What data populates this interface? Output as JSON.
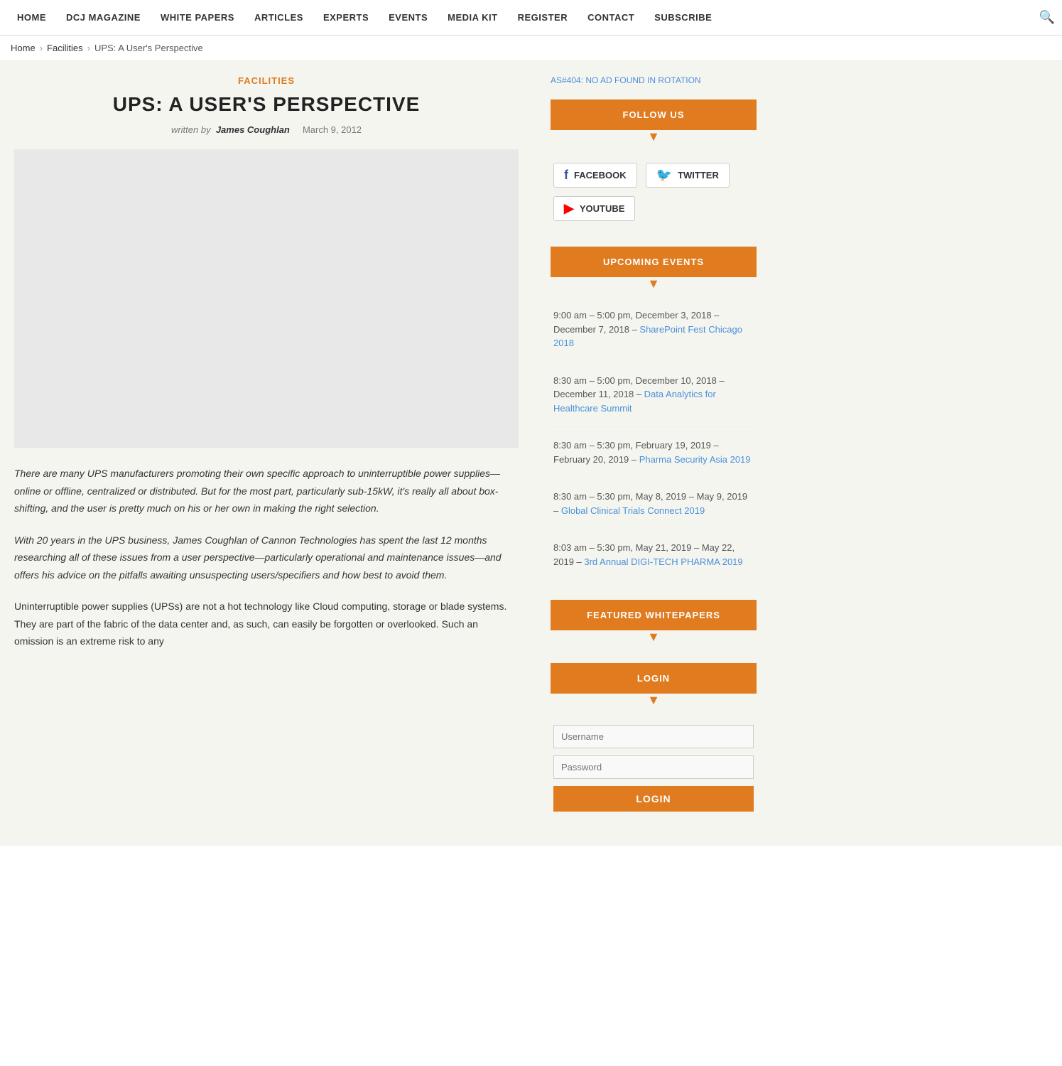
{
  "nav": {
    "items": [
      {
        "label": "HOME",
        "href": "#"
      },
      {
        "label": "DCJ MAGAZINE",
        "href": "#"
      },
      {
        "label": "WHITE PAPERS",
        "href": "#"
      },
      {
        "label": "ARTICLES",
        "href": "#"
      },
      {
        "label": "EXPERTS",
        "href": "#"
      },
      {
        "label": "EVENTS",
        "href": "#"
      },
      {
        "label": "MEDIA KIT",
        "href": "#"
      },
      {
        "label": "REGISTER",
        "href": "#"
      },
      {
        "label": "CONTACT",
        "href": "#"
      },
      {
        "label": "SUBSCRIBE",
        "href": "#"
      }
    ]
  },
  "breadcrumb": {
    "home": "Home",
    "facilities": "Facilities",
    "current": "UPS: A User's Perspective"
  },
  "article": {
    "category": "FACILITIES",
    "title": "UPS: A USER'S PERSPECTIVE",
    "written_by": "written by",
    "author": "James Coughlan",
    "date": "March 9, 2012",
    "body": [
      "There are many UPS manufacturers promoting their own specific approach to uninterruptible power supplies—online or offline, centralized or distributed. But for the most part, particularly sub-15kW, it's really all about box-shifting, and the user is pretty much on his or her own in making the right selection.",
      "With 20 years in the UPS business, James Coughlan of Cannon Technologies has spent the last 12 months researching all of these issues from a user perspective—particularly operational and maintenance issues—and offers his advice on the pitfalls awaiting unsuspecting users/specifiers and how best to avoid them.",
      "Uninterruptible power supplies (UPSs) are not a hot technology like Cloud computing, storage or blade systems. They are part of the fabric of the data center and, as such, can easily be forgotten or overlooked. Such an omission is an extreme risk to any"
    ]
  },
  "sidebar": {
    "ad_text": "AS#404: NO AD FOUND IN ROTATION",
    "follow_us": {
      "header": "FOLLOW US",
      "facebook_label": "FACEBOOK",
      "twitter_label": "TWITTER",
      "youtube_label": "YOUTUBE"
    },
    "upcoming_events": {
      "header": "UPCOMING EVENTS",
      "events": [
        {
          "time": "9:00 am – 5:00 pm, December 3, 2018 – December 7, 2018",
          "link_text": "SharePoint Fest Chicago 2018",
          "link": "#"
        },
        {
          "time": "8:30 am – 5:00 pm, December 10, 2018 – December 11, 2018",
          "link_text": "Data Analytics for Healthcare Summit",
          "link": "#"
        },
        {
          "time": "8:30 am – 5:30 pm, February 19, 2019 – February 20, 2019",
          "link_text": "Pharma Security Asia 2019",
          "link": "#"
        },
        {
          "time": "8:30 am – 5:30 pm, May 8, 2019 – May 9, 2019",
          "link_text": "Global Clinical Trials Connect 2019",
          "link": "#"
        },
        {
          "time": "8:03 am – 5:30 pm, May 21, 2019 – May 22, 2019",
          "link_text": "3rd Annual DIGI-TECH PHARMA 2019",
          "link": "#"
        }
      ]
    },
    "featured_whitepapers": {
      "header": "FEATURED WHITEPAPERS"
    },
    "login": {
      "header": "LOGIN",
      "username_placeholder": "Username",
      "password_placeholder": "Password",
      "button_label": "LOGIN"
    }
  }
}
